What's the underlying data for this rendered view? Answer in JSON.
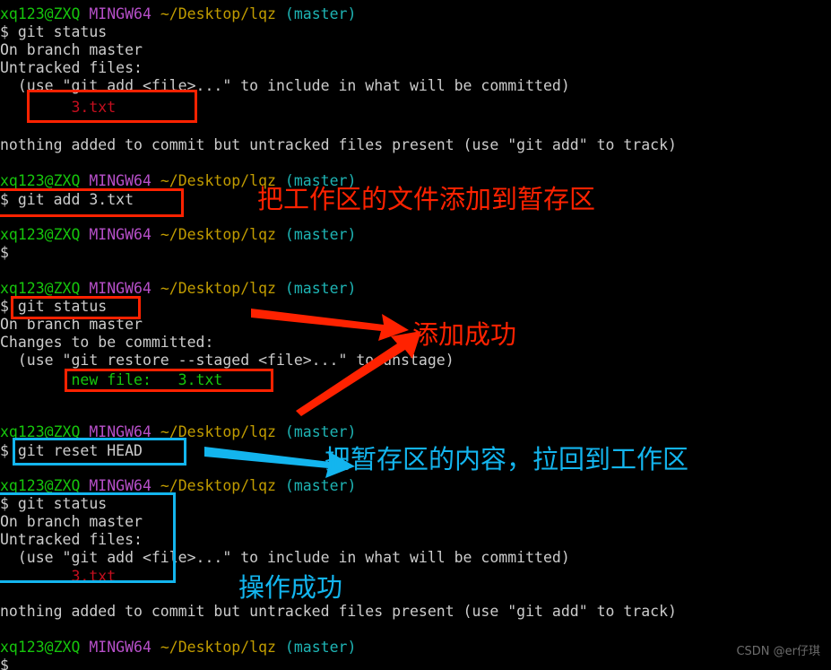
{
  "terminal": {
    "prompt_user": "xq123@ZXQ",
    "prompt_host": "MINGW64",
    "prompt_path": "~/Desktop/lqz",
    "prompt_branch": "(master)",
    "dollar": "$",
    "lines": {
      "cmd_status": "$ git status",
      "on_branch": "On branch master",
      "untracked_files": "Untracked files:",
      "use_git_add": "  (use \"git add <file>...\" to include in what will be committed)",
      "file_3txt": "        3.txt",
      "nothing_added": "nothing added to commit but untracked files present (use \"git add\" to track)",
      "cmd_add": "$ git add 3.txt",
      "dollar_only": "$",
      "changes_to_be_committed": "Changes to be committed:",
      "use_git_restore": "  (use \"git restore --staged <file>...\" to unstage)",
      "new_file_3txt": "        new file:   3.txt",
      "cmd_reset": "$ git reset HEAD"
    }
  },
  "annotations": {
    "note_add_to_stage": "把工作区的文件添加到暂存区",
    "note_add_success": "添加成功",
    "note_pull_back": "把暂存区的内容，拉回到工作区",
    "note_operation_success": "操作成功"
  },
  "watermark": {
    "text": "CSDN @er仔琪"
  },
  "colors": {
    "red": "#ff2200",
    "cyan": "#13b5ee",
    "user": "#16c60c",
    "host": "#b64fc8",
    "path": "#c19c00",
    "branch": "#1eb4b4",
    "output": "#cccccc"
  }
}
